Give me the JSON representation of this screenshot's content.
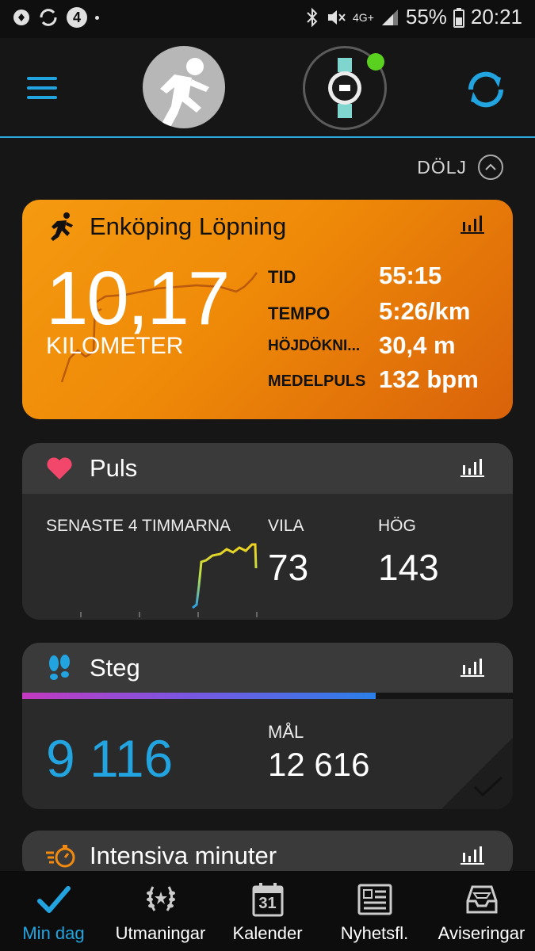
{
  "status_bar": {
    "network": "4G+",
    "battery": "55%",
    "time": "20:21",
    "notif_badge": "4"
  },
  "header": {
    "hide_label": "DÖLJ"
  },
  "activity": {
    "title": "Enköping Löpning",
    "distance": "10,17",
    "distance_unit": "KILOMETER",
    "stats": [
      {
        "label": "TID",
        "value": "55:15"
      },
      {
        "label": "TEMPO",
        "value": "5:26/km"
      },
      {
        "label": "HÖJDÖKNI...",
        "value": "30,4 m"
      },
      {
        "label": "MEDELPULS",
        "value": "132 bpm"
      }
    ],
    "color": "#f0900c"
  },
  "heart": {
    "title": "Puls",
    "period_label": "SENASTE 4 TIMMARNA",
    "rest_label": "VILA",
    "rest_value": "73",
    "high_label": "HÖG",
    "high_value": "143",
    "icon_color": "#f2476a"
  },
  "steps": {
    "title": "Steg",
    "value": "9 116",
    "goal_label": "MÅL",
    "goal_value": "12 616",
    "progress": 0.72,
    "color": "#21a4e0"
  },
  "intensity": {
    "title": "Intensiva minuter",
    "icon_color": "#f28a10"
  },
  "bottom_nav": [
    {
      "label": "Min dag",
      "icon": "checkmark-icon",
      "active": true
    },
    {
      "label": "Utmaningar",
      "icon": "laurel-icon",
      "active": false
    },
    {
      "label": "Kalender",
      "icon": "calendar-icon",
      "active": false
    },
    {
      "label": "Nyhetsfl.",
      "icon": "newsfeed-icon",
      "active": false
    },
    {
      "label": "Aviseringar",
      "icon": "inbox-icon",
      "active": false
    }
  ],
  "calendar_day": "31",
  "accent": "#21a4e0"
}
